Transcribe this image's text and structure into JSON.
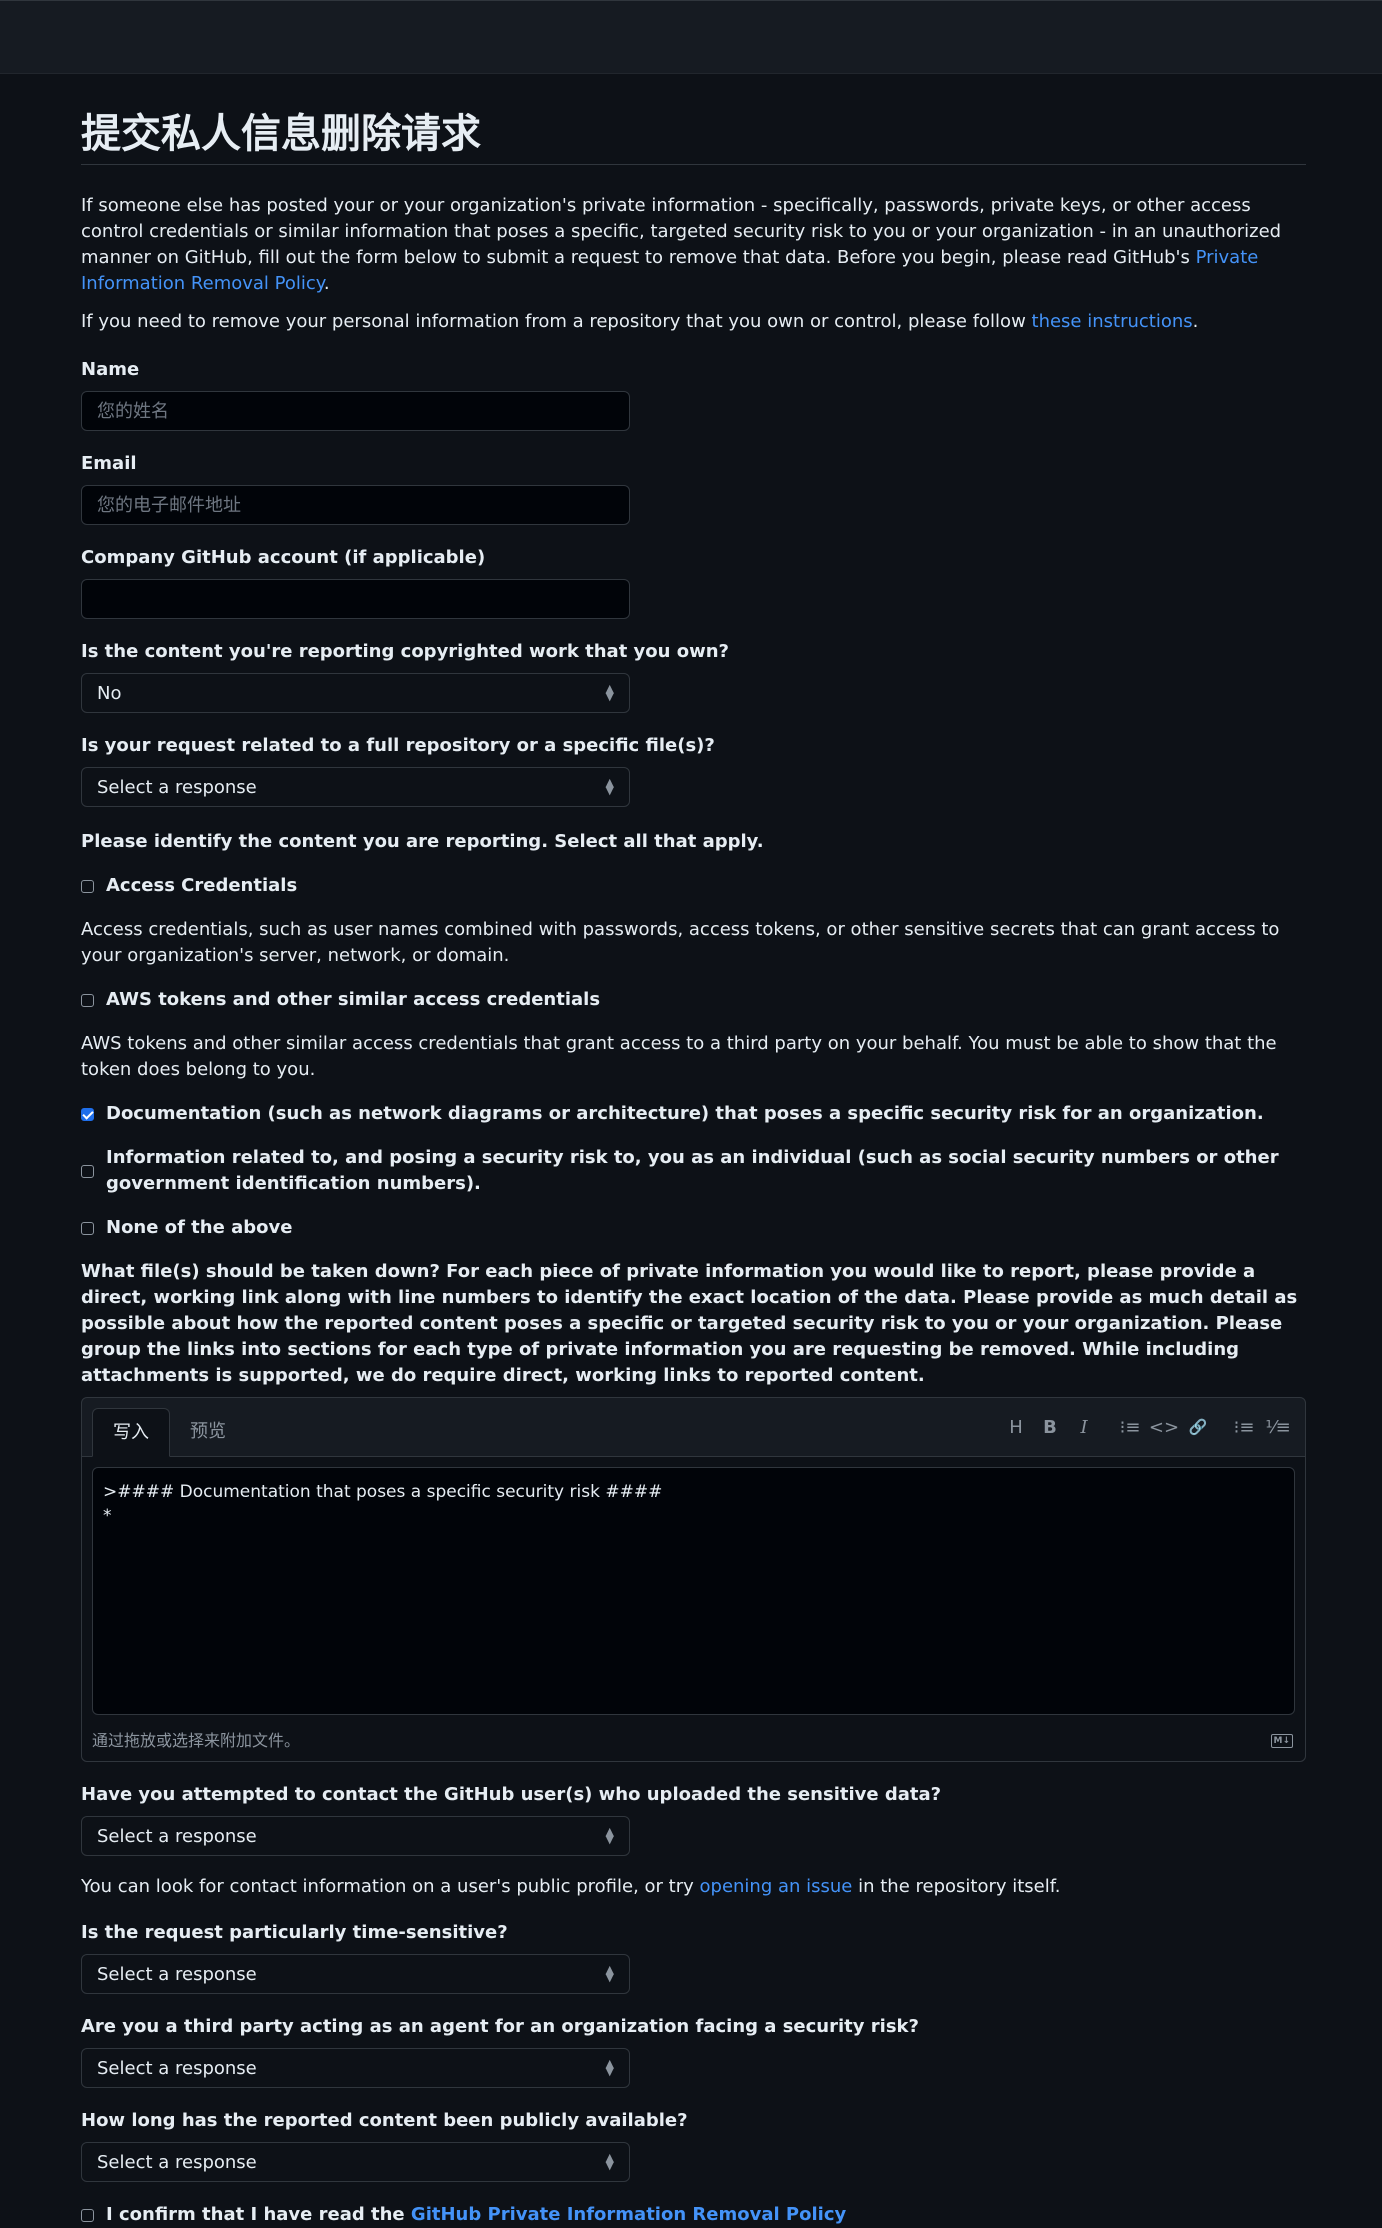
{
  "page": {
    "title": "提交私人信息删除请求",
    "intro_1": "If someone else has posted your or your organization's private information - specifically, passwords, private keys, or other access control credentials or similar information that poses a specific, targeted security risk to you or your organization - in an unauthorized manner on GitHub, fill out the form below to submit a request to remove that data. Before you begin, please read GitHub's ",
    "intro_1_link": "Private Information Removal Policy",
    "intro_1_end": ".",
    "intro_2": "If you need to remove your personal information from a repository that you own or control, please follow ",
    "intro_2_link": "these instructions",
    "intro_2_end": "."
  },
  "form": {
    "name_label": "Name",
    "name_placeholder": "您的姓名",
    "email_label": "Email",
    "email_placeholder": "您的电子邮件地址",
    "company_label": "Company GitHub account (if applicable)",
    "company_value": "",
    "copyright_label": "Is the content you're reporting copyrighted work that you own?",
    "copyright_value": "No",
    "scope_label": "Is your request related to a full repository or a specific file(s)?",
    "scope_value": "Select a response",
    "identify_label": "Please identify the content you are reporting. Select all that apply.",
    "options": {
      "access_credentials": "Access Credentials",
      "access_credentials_desc": "Access credentials, such as user names combined with passwords, access tokens, or other sensitive secrets that can grant access to your organization's server, network, or domain.",
      "aws_tokens": "AWS tokens and other similar access credentials",
      "aws_tokens_desc": "AWS tokens and other similar access credentials that grant access to a third party on your behalf. You must be able to show that the token does belong to you.",
      "documentation": "Documentation (such as network diagrams or architecture) that poses a specific security risk for an organization.",
      "individual_info": "Information related to, and posing a security risk to, you as an individual (such as social security numbers or other government identification numbers).",
      "none": "None of the above"
    },
    "files_label": "What file(s) should be taken down? For each piece of private information you would like to report, please provide a direct, working link along with line numbers to identify the exact location of the data. Please provide as much detail as possible about how the reported content poses a specific or targeted security risk to you or your organization. Please group the links into sections for each type of private information you are requesting be removed. While including attachments is supported, we do require direct, working links to reported content.",
    "editor": {
      "tab_write": "写入",
      "tab_preview": "预览",
      "tools": {
        "heading": "H",
        "bold": "B",
        "italic": "I",
        "quote": "⁝≡",
        "code": "<>",
        "link": "🔗",
        "ul": "⁝≡",
        "ol": "⅟≡"
      },
      "content": ">#### Documentation that poses a specific security risk ####\n*",
      "attach_hint": "通过拖放或选择来附加文件。",
      "md_badge": "M↓"
    },
    "contact_label": "Have you attempted to contact the GitHub user(s) who uploaded the sensitive data?",
    "contact_value": "Select a response",
    "contact_hint": "You can look for contact information on a user's public profile, or try ",
    "contact_hint_link": "opening an issue",
    "contact_hint_end": " in the repository itself.",
    "time_label": "Is the request particularly time-sensitive?",
    "time_value": "Select a response",
    "agent_label": "Are you a third party acting as an agent for an organization facing a security risk?",
    "agent_value": "Select a response",
    "duration_label": "How long has the reported content been publicly available?",
    "duration_value": "Select a response",
    "confirm_text": "I confirm that I have read the ",
    "confirm_link": "GitHub Private Information Removal Policy"
  },
  "colors": {
    "background": "#0d1117",
    "link": "#4493f8",
    "checkbox_checked": "#1f6feb"
  }
}
